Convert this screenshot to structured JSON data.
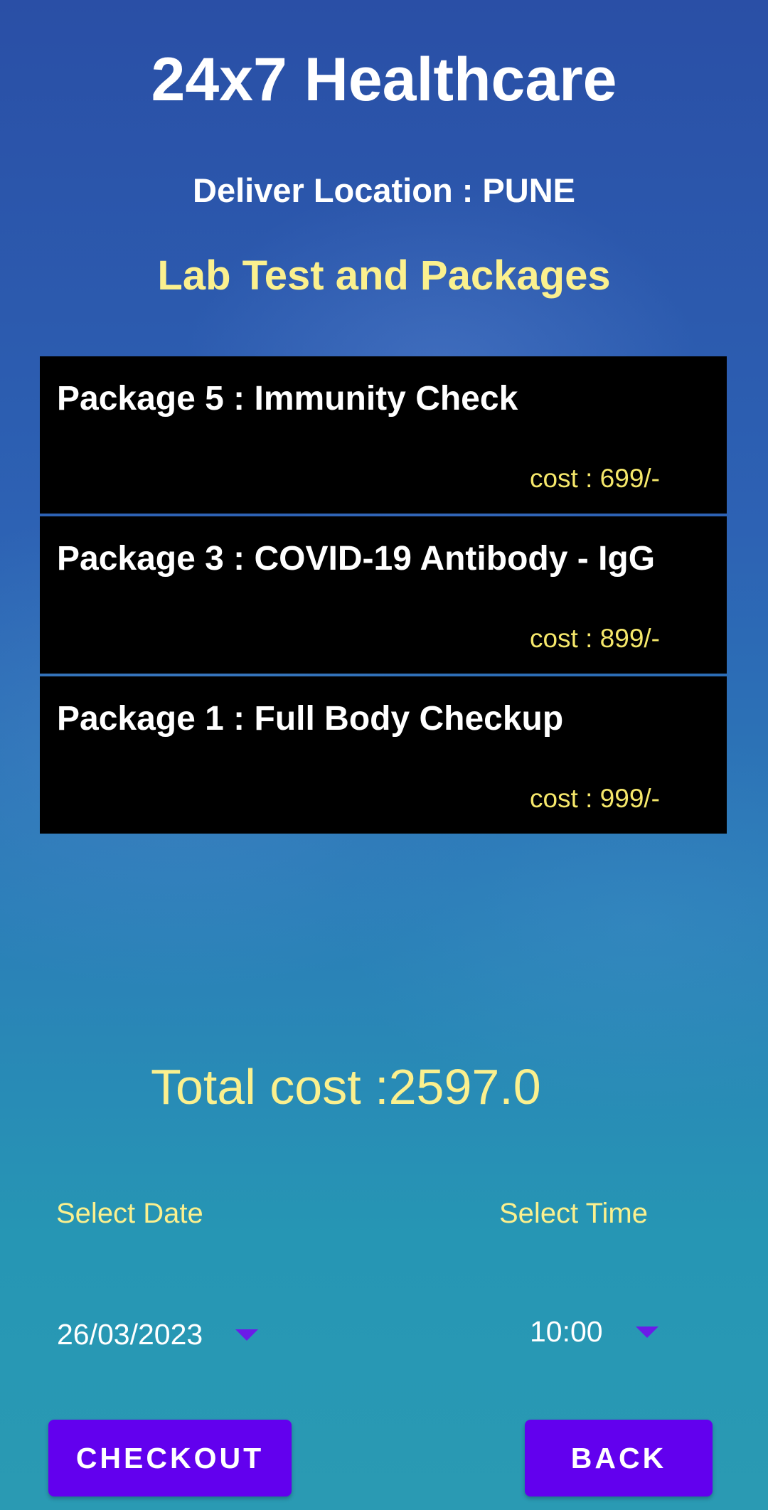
{
  "header": {
    "app_title": "24x7 Healthcare",
    "location": "Deliver Location : PUNE",
    "section_title": "Lab Test and Packages"
  },
  "packages": [
    {
      "name": "Package 5 : Immunity Check",
      "cost": "cost : 699/-"
    },
    {
      "name": "Package 3 : COVID-19 Antibody - IgG",
      "cost": "cost : 899/-"
    },
    {
      "name": "Package 1 : Full Body Checkup",
      "cost": "cost : 999/-"
    }
  ],
  "summary": {
    "total_cost": "Total cost :2597.0"
  },
  "schedule": {
    "date_label": "Select Date",
    "time_label": "Select Time",
    "date_value": "26/03/2023",
    "time_value": "10:00"
  },
  "actions": {
    "checkout_label": "CHECKOUT",
    "back_label": "BACK"
  },
  "colors": {
    "accent": "#6200ee",
    "highlight_text": "#fbf08e",
    "card_background": "#000000"
  },
  "icons": {
    "dropdown": "dropdown-caret-icon"
  }
}
